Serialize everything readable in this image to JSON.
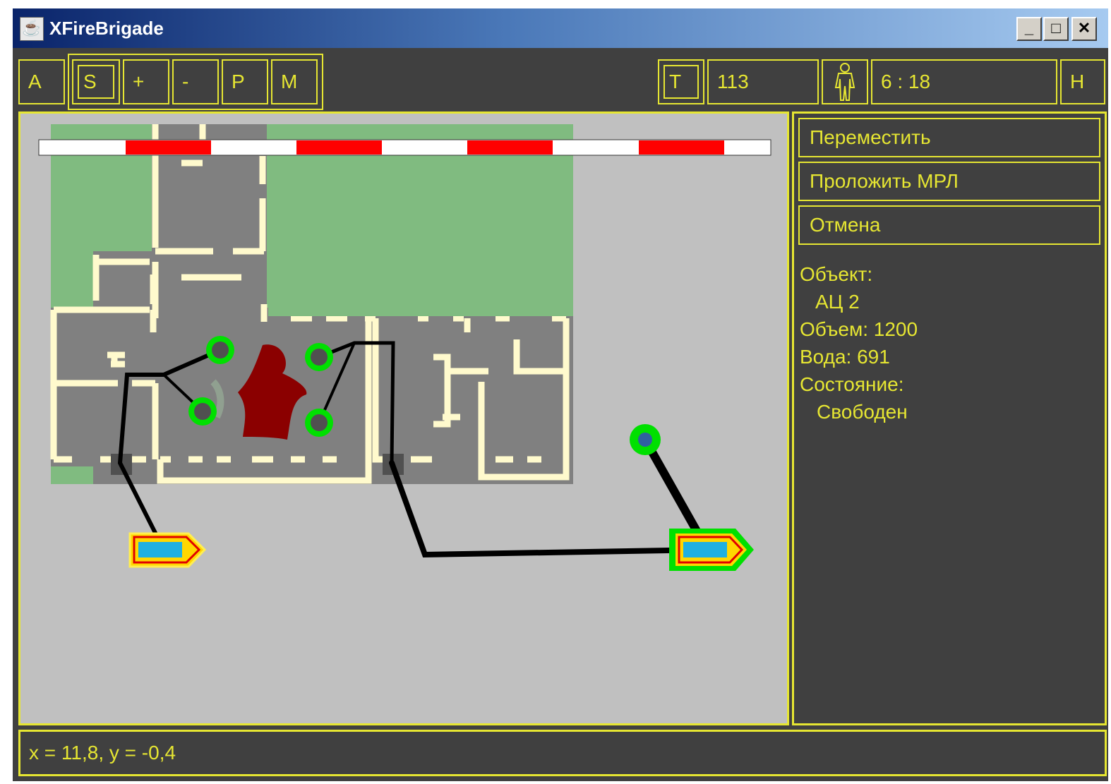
{
  "window": {
    "title": "XFireBrigade",
    "icon": "java-cup-icon",
    "controls": {
      "minimize": "_",
      "maximize": "□",
      "close": "✕"
    }
  },
  "toolbar": {
    "a": "A",
    "s": "S",
    "zoom_in": "+",
    "zoom_out": "-",
    "p": "P",
    "m": "M",
    "t": "T",
    "t_value": "113",
    "person_icon": "person-icon",
    "time": "6 : 18",
    "h": "H"
  },
  "actions": {
    "move": "Переместить",
    "lay_line": "Проложить МРЛ",
    "cancel": "Отмена"
  },
  "object_info": {
    "object_label": "Объект:",
    "object_value": "АЦ 2",
    "volume": "Объем: 1200",
    "water": "Вода: 691",
    "state_label": "Состояние:",
    "state_value": "Свободен"
  },
  "status": {
    "coords": "x = 11,8, y = -0,4"
  },
  "colors": {
    "accent": "#e6e632",
    "panel_bg": "#404040",
    "map_bg": "#c0c0c0",
    "grass": "#80bb80",
    "floor": "#808080",
    "wall": "#fffacd",
    "fire": "#8b0000",
    "unit_ring": "#00e000",
    "truck_body": "#20b0e0",
    "scale_red": "#ff0000"
  }
}
